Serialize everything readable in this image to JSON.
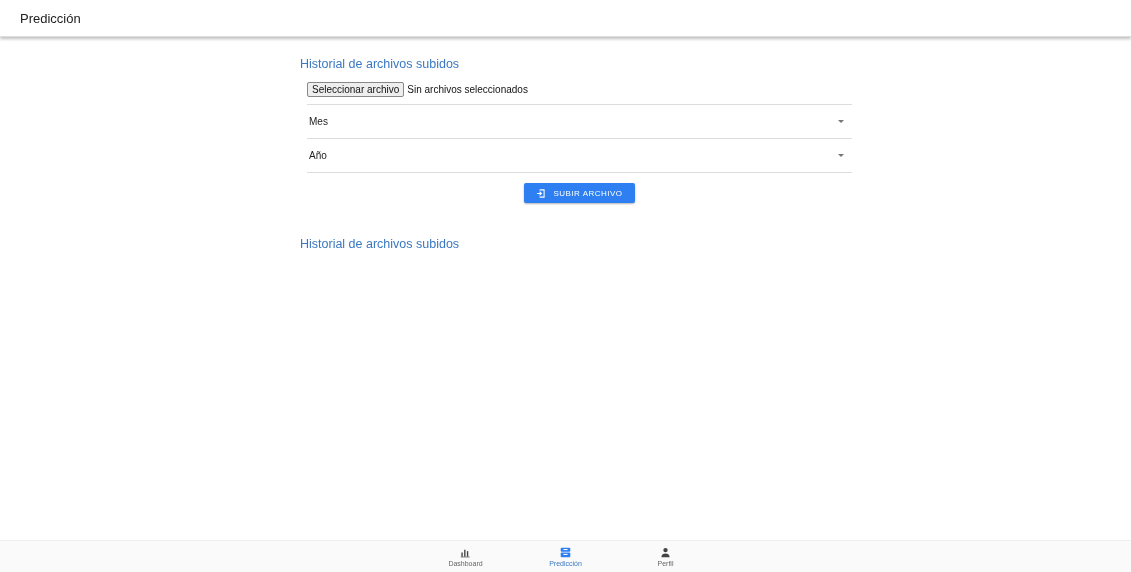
{
  "app_bar": {
    "title": "Predicción"
  },
  "upload_section": {
    "title": "Historial de archivos subidos",
    "file_button": "Seleccionar archivo",
    "file_status": "Sin archivos seleccionados",
    "selects": [
      {
        "label": "Mes"
      },
      {
        "label": "Año"
      }
    ],
    "submit_button": "SUBIR ARCHIVO"
  },
  "history_section": {
    "title": "Historial de archivos subidos"
  },
  "bottom_nav": [
    {
      "kind": "chart",
      "label": "Dashboard",
      "selected": false
    },
    {
      "kind": "inbox",
      "label": "Predicción",
      "selected": true
    },
    {
      "kind": "person",
      "label": "Perfil",
      "selected": false
    }
  ]
}
